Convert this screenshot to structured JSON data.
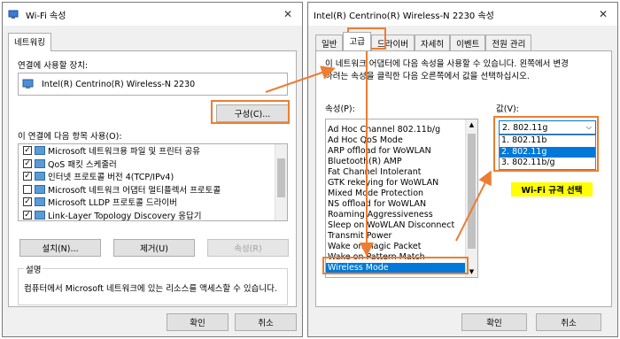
{
  "left": {
    "title": "Wi-Fi 속성",
    "tab": "네트워킹",
    "connect_using_label": "연결에 사용할 장치:",
    "adapter_name": "Intel(R) Centrino(R) Wireless-N 2230",
    "configure_button": "구성(C)...",
    "items_label": "이 연결에 다음 항목 사용(O):",
    "items": [
      {
        "checked": true,
        "icon": "network-client-icon",
        "label": "Microsoft 네트워크용 파일 및 프린터 공유"
      },
      {
        "checked": true,
        "icon": "qos-icon",
        "label": "QoS 패킷 스케줄러"
      },
      {
        "checked": true,
        "icon": "protocol-icon",
        "label": "인터넷 프로토콜 버전 4(TCP/IPv4)"
      },
      {
        "checked": false,
        "icon": "protocol-icon",
        "label": "Microsoft 네트워크 어댑터 멀티플렉서 프로토콜"
      },
      {
        "checked": true,
        "icon": "protocol-icon",
        "label": "Microsoft LLDP 프로토콜 드라이버"
      },
      {
        "checked": true,
        "icon": "protocol-icon",
        "label": "Link-Layer Topology Discovery 응답기"
      }
    ],
    "install_button": "설치(N)...",
    "uninstall_button": "제거(U)",
    "properties_button": "속성(R)",
    "description_title": "설명",
    "description_text": "컴퓨터에서 Microsoft 네트워크에 있는 리소스를 액세스할 수 있습니다.",
    "ok_button": "확인",
    "cancel_button": "취소"
  },
  "right": {
    "title": "Intel(R) Centrino(R) Wireless-N 2230 속성",
    "tabs": [
      "일반",
      "고급",
      "드라이버",
      "자세히",
      "이벤트",
      "전원 관리"
    ],
    "selected_tab": 1,
    "intro_text_1": "이 네트워크 어댑터에 다음 속성을 사용할 수 있습니다. 왼쪽에서 변경",
    "intro_text_2": "하려는 속성을 클릭한 다음 오른쪽에서 값을 선택하십시오.",
    "property_label": "속성(P):",
    "value_label": "값(V):",
    "properties": [
      "Ad Hoc Channel 802.11b/g",
      "Ad Hoc QoS Mode",
      "ARP offload for WoWLAN",
      "Bluetooth(R) AMP",
      "Fat Channel Intolerant",
      "GTK rekeying for WoWLAN",
      "Mixed Mode Protection",
      "NS offload for WoWLAN",
      "Roaming Aggressiveness",
      "Sleep on WoWLAN Disconnect",
      "Transmit Power",
      "Wake on Magic Packet",
      "Wake on Pattern Match",
      "Wireless Mode"
    ],
    "selected_property": 13,
    "value_selected": "2. 802.11g",
    "value_options": [
      "1. 802.11b",
      "2. 802.11g",
      "3. 802.11b/g"
    ],
    "selected_option": 1,
    "annotation": "Wi-Fi 규격 선택",
    "ok_button": "확인",
    "cancel_button": "취소"
  },
  "colors": {
    "accent": "#ed7d31",
    "selection": "#0078d7",
    "highlight": "#ffff00"
  }
}
